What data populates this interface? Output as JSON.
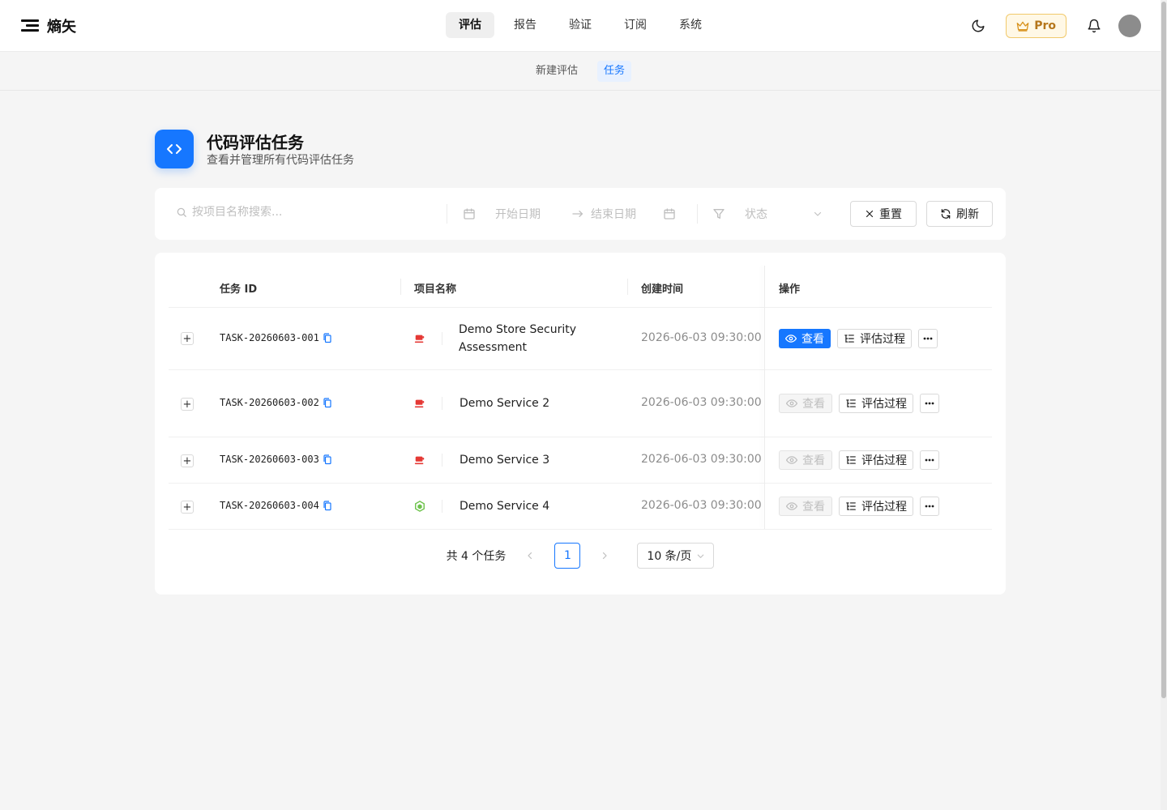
{
  "app": {
    "logo_text": "熵矢"
  },
  "nav": {
    "items": [
      {
        "label": "评估",
        "active": true
      },
      {
        "label": "报告"
      },
      {
        "label": "验证"
      },
      {
        "label": "订阅"
      },
      {
        "label": "系统"
      }
    ]
  },
  "header_right": {
    "pro_label": "Pro"
  },
  "subnav": {
    "items": [
      {
        "label": "新建评估"
      },
      {
        "label": "任务",
        "active": true
      }
    ]
  },
  "page": {
    "title": "代码评估任务",
    "subtitle": "查看并管理所有代码评估任务"
  },
  "filters": {
    "search_placeholder": "按项目名称搜索...",
    "start_date": "开始日期",
    "end_date": "结束日期",
    "status": "状态",
    "reset_label": "重置",
    "refresh_label": "刷新"
  },
  "table": {
    "columns": [
      "任务 ID",
      "项目名称",
      "创建时间",
      "操作"
    ],
    "rows": [
      {
        "task_id": "TASK-20260603-001",
        "lang_icon": "java-icon",
        "project": "Demo Store Security Assessment",
        "created": "2026-06-03 09:30:00",
        "view_enabled": true
      },
      {
        "task_id": "TASK-20260603-002",
        "lang_icon": "java-icon",
        "project": "Demo Service 2",
        "created": "2026-06-03 09:30:00",
        "view_enabled": false
      },
      {
        "task_id": "TASK-20260603-003",
        "lang_icon": "java-icon",
        "project": "Demo Service 3",
        "created": "2026-06-03 09:30:00",
        "view_enabled": false
      },
      {
        "task_id": "TASK-20260603-004",
        "lang_icon": "nodejs-icon",
        "project": "Demo Service 4",
        "created": "2026-06-03 09:30:00",
        "view_enabled": false
      }
    ],
    "expand_symbol": "+",
    "view_label": "查看",
    "process_label": "评估过程"
  },
  "pagination": {
    "total_text": "共 4 个任务",
    "current_page": "1",
    "page_size": "10 条/页"
  },
  "colors": {
    "primary": "#1677ff",
    "java": "#e53935",
    "nodejs": "#6cc24a",
    "pro_gold": "#b5761b"
  }
}
